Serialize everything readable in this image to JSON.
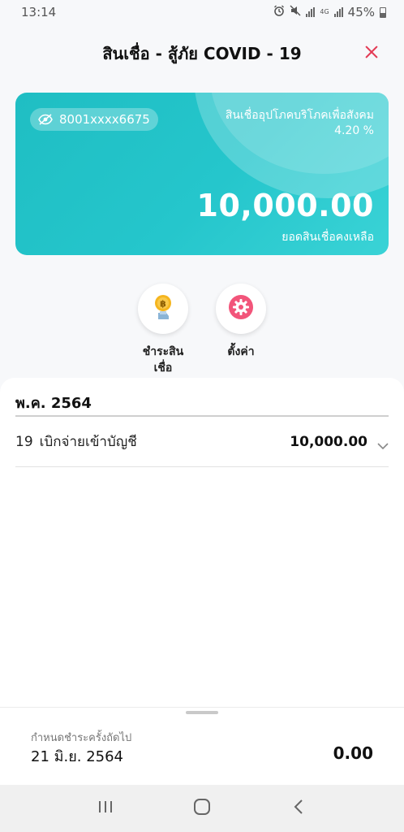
{
  "status_bar": {
    "time": "13:14",
    "network": "4G",
    "battery": "45%"
  },
  "header": {
    "title": "สินเชื่อ - สู้ภัย COVID - 19"
  },
  "card": {
    "account_number": "8001xxxx6675",
    "product_name": "สินเชื่ออุปโภคบริโภคเพื่อสังคม",
    "interest_rate": "4.20 %",
    "balance": "10,000.00",
    "balance_label": "ยอดสินเชื่อคงเหลือ",
    "color": "#25c6cc"
  },
  "actions": {
    "pay_label": "ชำระสินเชื่อ",
    "settings_label": "ตั้งค่า"
  },
  "transactions": {
    "month": "พ.ค. 2564",
    "items": [
      {
        "day": "19",
        "description": "เบิกจ่ายเข้าบัญชี",
        "amount": "10,000.00"
      }
    ]
  },
  "summary": {
    "due_label": "กำหนดชำระครั้งถัดไป",
    "due_date": "21 มิ.ย. 2564",
    "due_amount": "0.00"
  },
  "colors": {
    "accent_close": "#e33b55",
    "settings_icon": "#f2557a",
    "pay_icon": "#f5b51e"
  }
}
